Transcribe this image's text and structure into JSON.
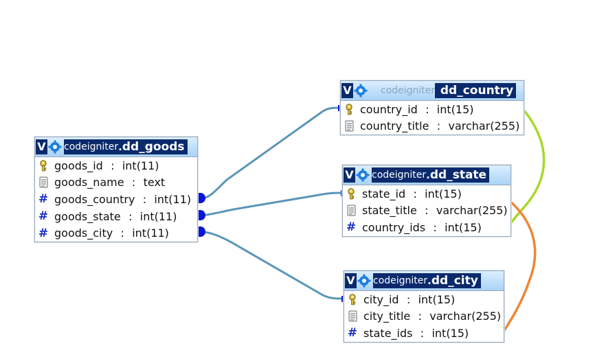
{
  "colors": {
    "connector": "#5b95b8",
    "connector_end": "#0a16d6",
    "country_state_link": "#a8d82a",
    "state_city_link": "#ee8533",
    "header_bg": "#0b2a6c",
    "key_icon": "#c7a318",
    "hash_icon": "#1a30c8"
  },
  "tables": [
    {
      "database": "codeigniter",
      "name": "dd_goods",
      "header_style": "dark",
      "columns": [
        {
          "icon": "key-icon",
          "name": "goods_id",
          "type": "int(11)"
        },
        {
          "icon": "text-icon",
          "name": "goods_name",
          "type": "text"
        },
        {
          "icon": "hash-icon",
          "name": "goods_country",
          "type": "int(11)"
        },
        {
          "icon": "hash-icon",
          "name": "goods_state",
          "type": "int(11)"
        },
        {
          "icon": "hash-icon",
          "name": "goods_city",
          "type": "int(11)"
        }
      ]
    },
    {
      "database": "codeigniter",
      "name": "dd_country",
      "header_style": "light",
      "columns": [
        {
          "icon": "key-icon",
          "name": "country_id",
          "type": "int(15)"
        },
        {
          "icon": "text-icon",
          "name": "country_title",
          "type": "varchar(255)"
        }
      ]
    },
    {
      "database": "codeigniter",
      "name": "dd_state",
      "header_style": "dark",
      "columns": [
        {
          "icon": "key-icon",
          "name": "state_id",
          "type": "int(15)"
        },
        {
          "icon": "text-icon",
          "name": "state_title",
          "type": "varchar(255)"
        },
        {
          "icon": "hash-icon",
          "name": "country_ids",
          "type": "int(15)"
        }
      ]
    },
    {
      "database": "codeigniter",
      "name": "dd_city",
      "header_style": "dark",
      "columns": [
        {
          "icon": "key-icon",
          "name": "city_id",
          "type": "int(15)"
        },
        {
          "icon": "text-icon",
          "name": "city_title",
          "type": "varchar(255)"
        },
        {
          "icon": "hash-icon",
          "name": "state_ids",
          "type": "int(15)"
        }
      ]
    }
  ],
  "header_letter": "V",
  "separator": ":"
}
